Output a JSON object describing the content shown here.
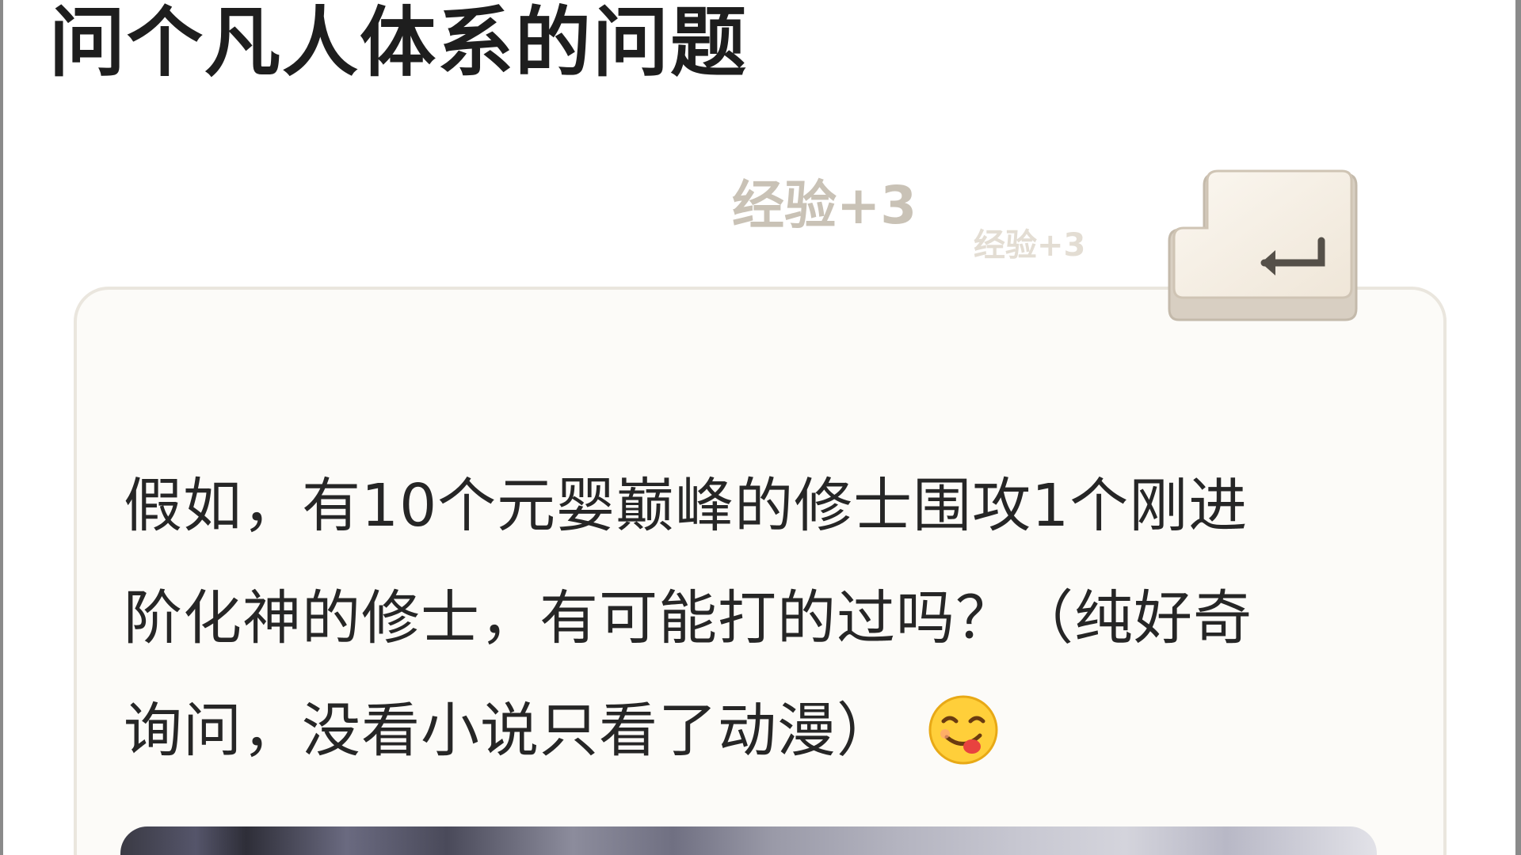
{
  "post": {
    "title": "问个凡人体系的问题",
    "body_lines": [
      "假如，有10个元婴巅峰的修士围攻1个刚进",
      "阶化神的修士，有可能打的过吗？（纯好奇",
      "询问，没看小说只看了动漫）"
    ],
    "emoji_icon": "yum-face-icon"
  },
  "experience": {
    "main_label": "经验+3",
    "small_label": "经验+3"
  },
  "enter_key": {
    "icon": "enter-key-icon"
  },
  "colors": {
    "title": "#1e1e1e",
    "body_text": "#262626",
    "card_background": "#fcfbf8",
    "card_border": "#eae6de",
    "exp_text": "#c9c2b6",
    "key_face": "#f5efe6"
  }
}
